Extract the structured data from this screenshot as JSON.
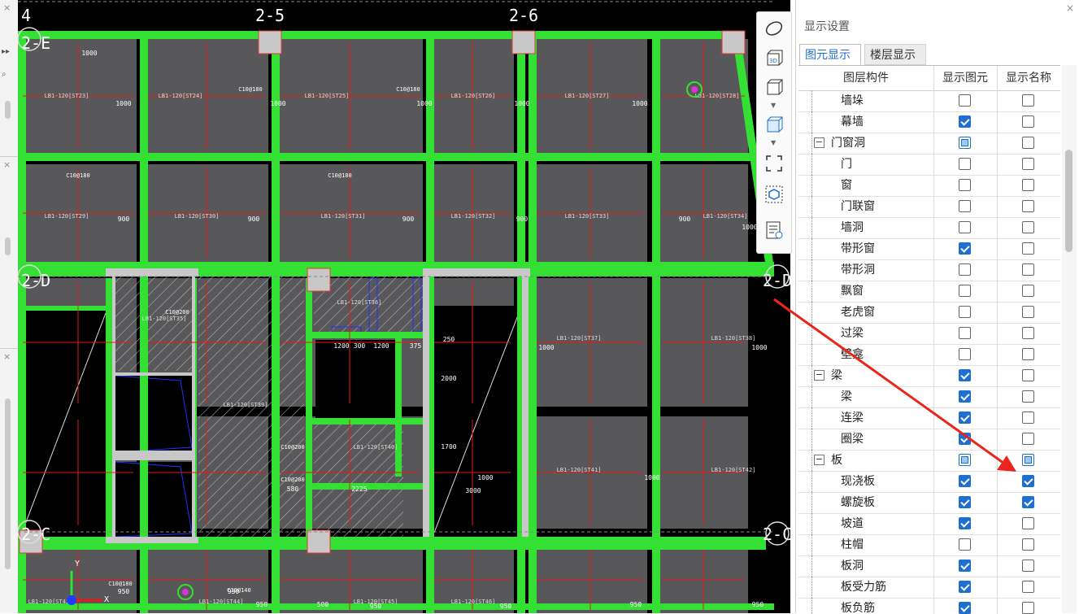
{
  "colors": {
    "cad_background": "#000000",
    "slab": "#58585a",
    "beam": "#33e033",
    "dim_red": "#e01b1b",
    "column": "#c8c8c8",
    "annotation_arrow": "#e8261e",
    "checkbox_blue": "#1e6fd0"
  },
  "icons": {
    "view_toolbar": [
      "orbit-icon",
      "3d-view-icon",
      "cube-view-icon",
      "cube-shaded-icon",
      "fit-window-icon",
      "element-display-icon",
      "property-list-icon"
    ]
  },
  "left_strip": {
    "close_marks": [
      "×",
      "×",
      "×"
    ]
  },
  "canvas": {
    "axis_labels": [
      "4",
      "2-5",
      "2-6",
      "2-E",
      "2-D",
      "2-C",
      "2-D",
      "2-C"
    ],
    "dims": [
      "1000",
      "1000",
      "1000",
      "1000",
      "1000",
      "1000",
      "900",
      "900",
      "900",
      "900",
      "900",
      "1000",
      "1000",
      "1000",
      "1000",
      "1200",
      "300",
      "1200",
      "375",
      "250",
      "2000",
      "1700",
      "2225",
      "3000",
      "1000",
      "950",
      "950",
      "500",
      "950",
      "950",
      "950",
      "950",
      "950",
      "580"
    ],
    "slab_labels": [
      "LB1-120[ST23]",
      "LB1-120[ST24]",
      "LB1-120[ST25]",
      "LB1-120[ST26]",
      "LB1-120[ST27]",
      "LB1-120[ST28]",
      "LB1-120[ST29]",
      "LB1-120[ST30]",
      "LB1-120[ST31]",
      "LB1-120[ST32]",
      "LB1-120[ST33]",
      "LB1-120[ST34]",
      "LB1-120[ST35]",
      "LB1-120[ST36]",
      "LB1-120[ST37]",
      "LB1-120[ST38]",
      "LB1-120[ST39]",
      "LB1-120[ST40]",
      "LB1-120[ST41]",
      "LB1-120[ST42]",
      "LB1-120[ST43]",
      "LB1-120[ST44]",
      "LB1-120[ST45]",
      "LB1-120[ST46]"
    ],
    "rebar": [
      "C10@180",
      "C10@180",
      "C10@180",
      "C10@180",
      "C10@200",
      "C10@200",
      "C10@200",
      "C10@180",
      "C10@140"
    ],
    "axis_origin": {
      "x_label": "X",
      "y_label": "Y"
    }
  },
  "panel": {
    "close": "×",
    "title": "显示设置",
    "tabs": [
      {
        "label": "图元显示",
        "active": true
      },
      {
        "label": "楼层显示",
        "active": false
      }
    ],
    "columns": [
      "图层构件",
      "显示图元",
      "显示名称"
    ],
    "rows": [
      {
        "label": "墙垛",
        "level": 1,
        "show": "unchecked",
        "name": "unchecked"
      },
      {
        "label": "幕墙",
        "level": 1,
        "show": "checked",
        "name": "unchecked"
      },
      {
        "label": "门窗洞",
        "level": 0,
        "expander": "−",
        "show": "partial",
        "name": "unchecked"
      },
      {
        "label": "门",
        "level": 1,
        "show": "unchecked",
        "name": "unchecked"
      },
      {
        "label": "窗",
        "level": 1,
        "show": "unchecked",
        "name": "unchecked"
      },
      {
        "label": "门联窗",
        "level": 1,
        "show": "unchecked",
        "name": "unchecked"
      },
      {
        "label": "墙洞",
        "level": 1,
        "show": "unchecked",
        "name": "unchecked"
      },
      {
        "label": "带形窗",
        "level": 1,
        "show": "checked",
        "name": "unchecked"
      },
      {
        "label": "带形洞",
        "level": 1,
        "show": "unchecked",
        "name": "unchecked"
      },
      {
        "label": "飘窗",
        "level": 1,
        "show": "unchecked",
        "name": "unchecked"
      },
      {
        "label": "老虎窗",
        "level": 1,
        "show": "unchecked",
        "name": "unchecked"
      },
      {
        "label": "过梁",
        "level": 1,
        "show": "unchecked",
        "name": "unchecked"
      },
      {
        "label": "壁龛",
        "level": 1,
        "show": "unchecked",
        "name": "unchecked"
      },
      {
        "label": "梁",
        "level": 0,
        "expander": "−",
        "show": "checked",
        "name": "unchecked"
      },
      {
        "label": "梁",
        "level": 1,
        "show": "checked",
        "name": "unchecked"
      },
      {
        "label": "连梁",
        "level": 1,
        "show": "checked",
        "name": "unchecked"
      },
      {
        "label": "圈梁",
        "level": 1,
        "show": "checked",
        "name": "unchecked"
      },
      {
        "label": "板",
        "level": 0,
        "expander": "−",
        "show": "partial",
        "name": "partial"
      },
      {
        "label": "现浇板",
        "level": 1,
        "show": "checked",
        "name": "checked"
      },
      {
        "label": "螺旋板",
        "level": 1,
        "show": "checked",
        "name": "checked"
      },
      {
        "label": "坡道",
        "level": 1,
        "show": "checked",
        "name": "unchecked"
      },
      {
        "label": "柱帽",
        "level": 1,
        "show": "unchecked",
        "name": "unchecked"
      },
      {
        "label": "板洞",
        "level": 1,
        "show": "checked",
        "name": "unchecked"
      },
      {
        "label": "板受力筋",
        "level": 1,
        "show": "checked",
        "name": "unchecked"
      },
      {
        "label": "板负筋",
        "level": 1,
        "show": "checked",
        "name": "unchecked"
      }
    ]
  }
}
